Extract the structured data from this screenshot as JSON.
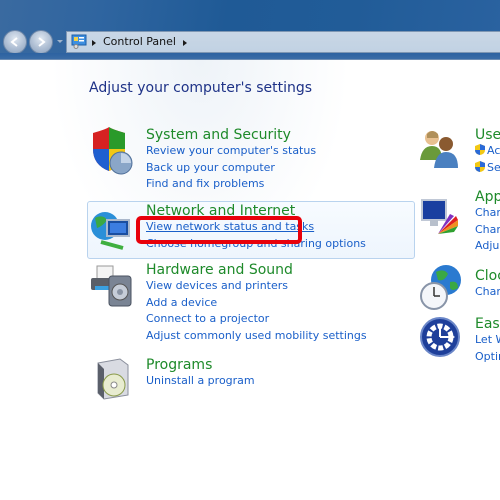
{
  "window": {
    "breadcrumb": [
      "Control Panel"
    ]
  },
  "page": {
    "title": "Adjust your computer's settings"
  },
  "categories": [
    {
      "title": "System and Security",
      "links": [
        "Review your computer's status",
        "Back up your computer",
        "Find and fix problems"
      ]
    },
    {
      "title": "Network and Internet",
      "links": [
        "View network status and tasks",
        "Choose homegroup and sharing options"
      ],
      "highlighted": true
    },
    {
      "title": "Hardware and Sound",
      "links": [
        "View devices and printers",
        "Add a device",
        "Connect to a projector",
        "Adjust commonly used mobility settings"
      ]
    },
    {
      "title": "Programs",
      "links": [
        "Uninstall a program"
      ]
    },
    {
      "title": "Use",
      "links": [
        "Ac",
        "Se"
      ]
    },
    {
      "title": "App",
      "links": [
        "Char",
        "Char",
        "Adju"
      ]
    },
    {
      "title": "Cloc",
      "links": [
        "Char"
      ]
    },
    {
      "title": "Ease",
      "links": [
        "Let W",
        "Optir"
      ]
    }
  ],
  "annotation": {
    "color": "#e8000b",
    "target": "View network status and tasks"
  }
}
